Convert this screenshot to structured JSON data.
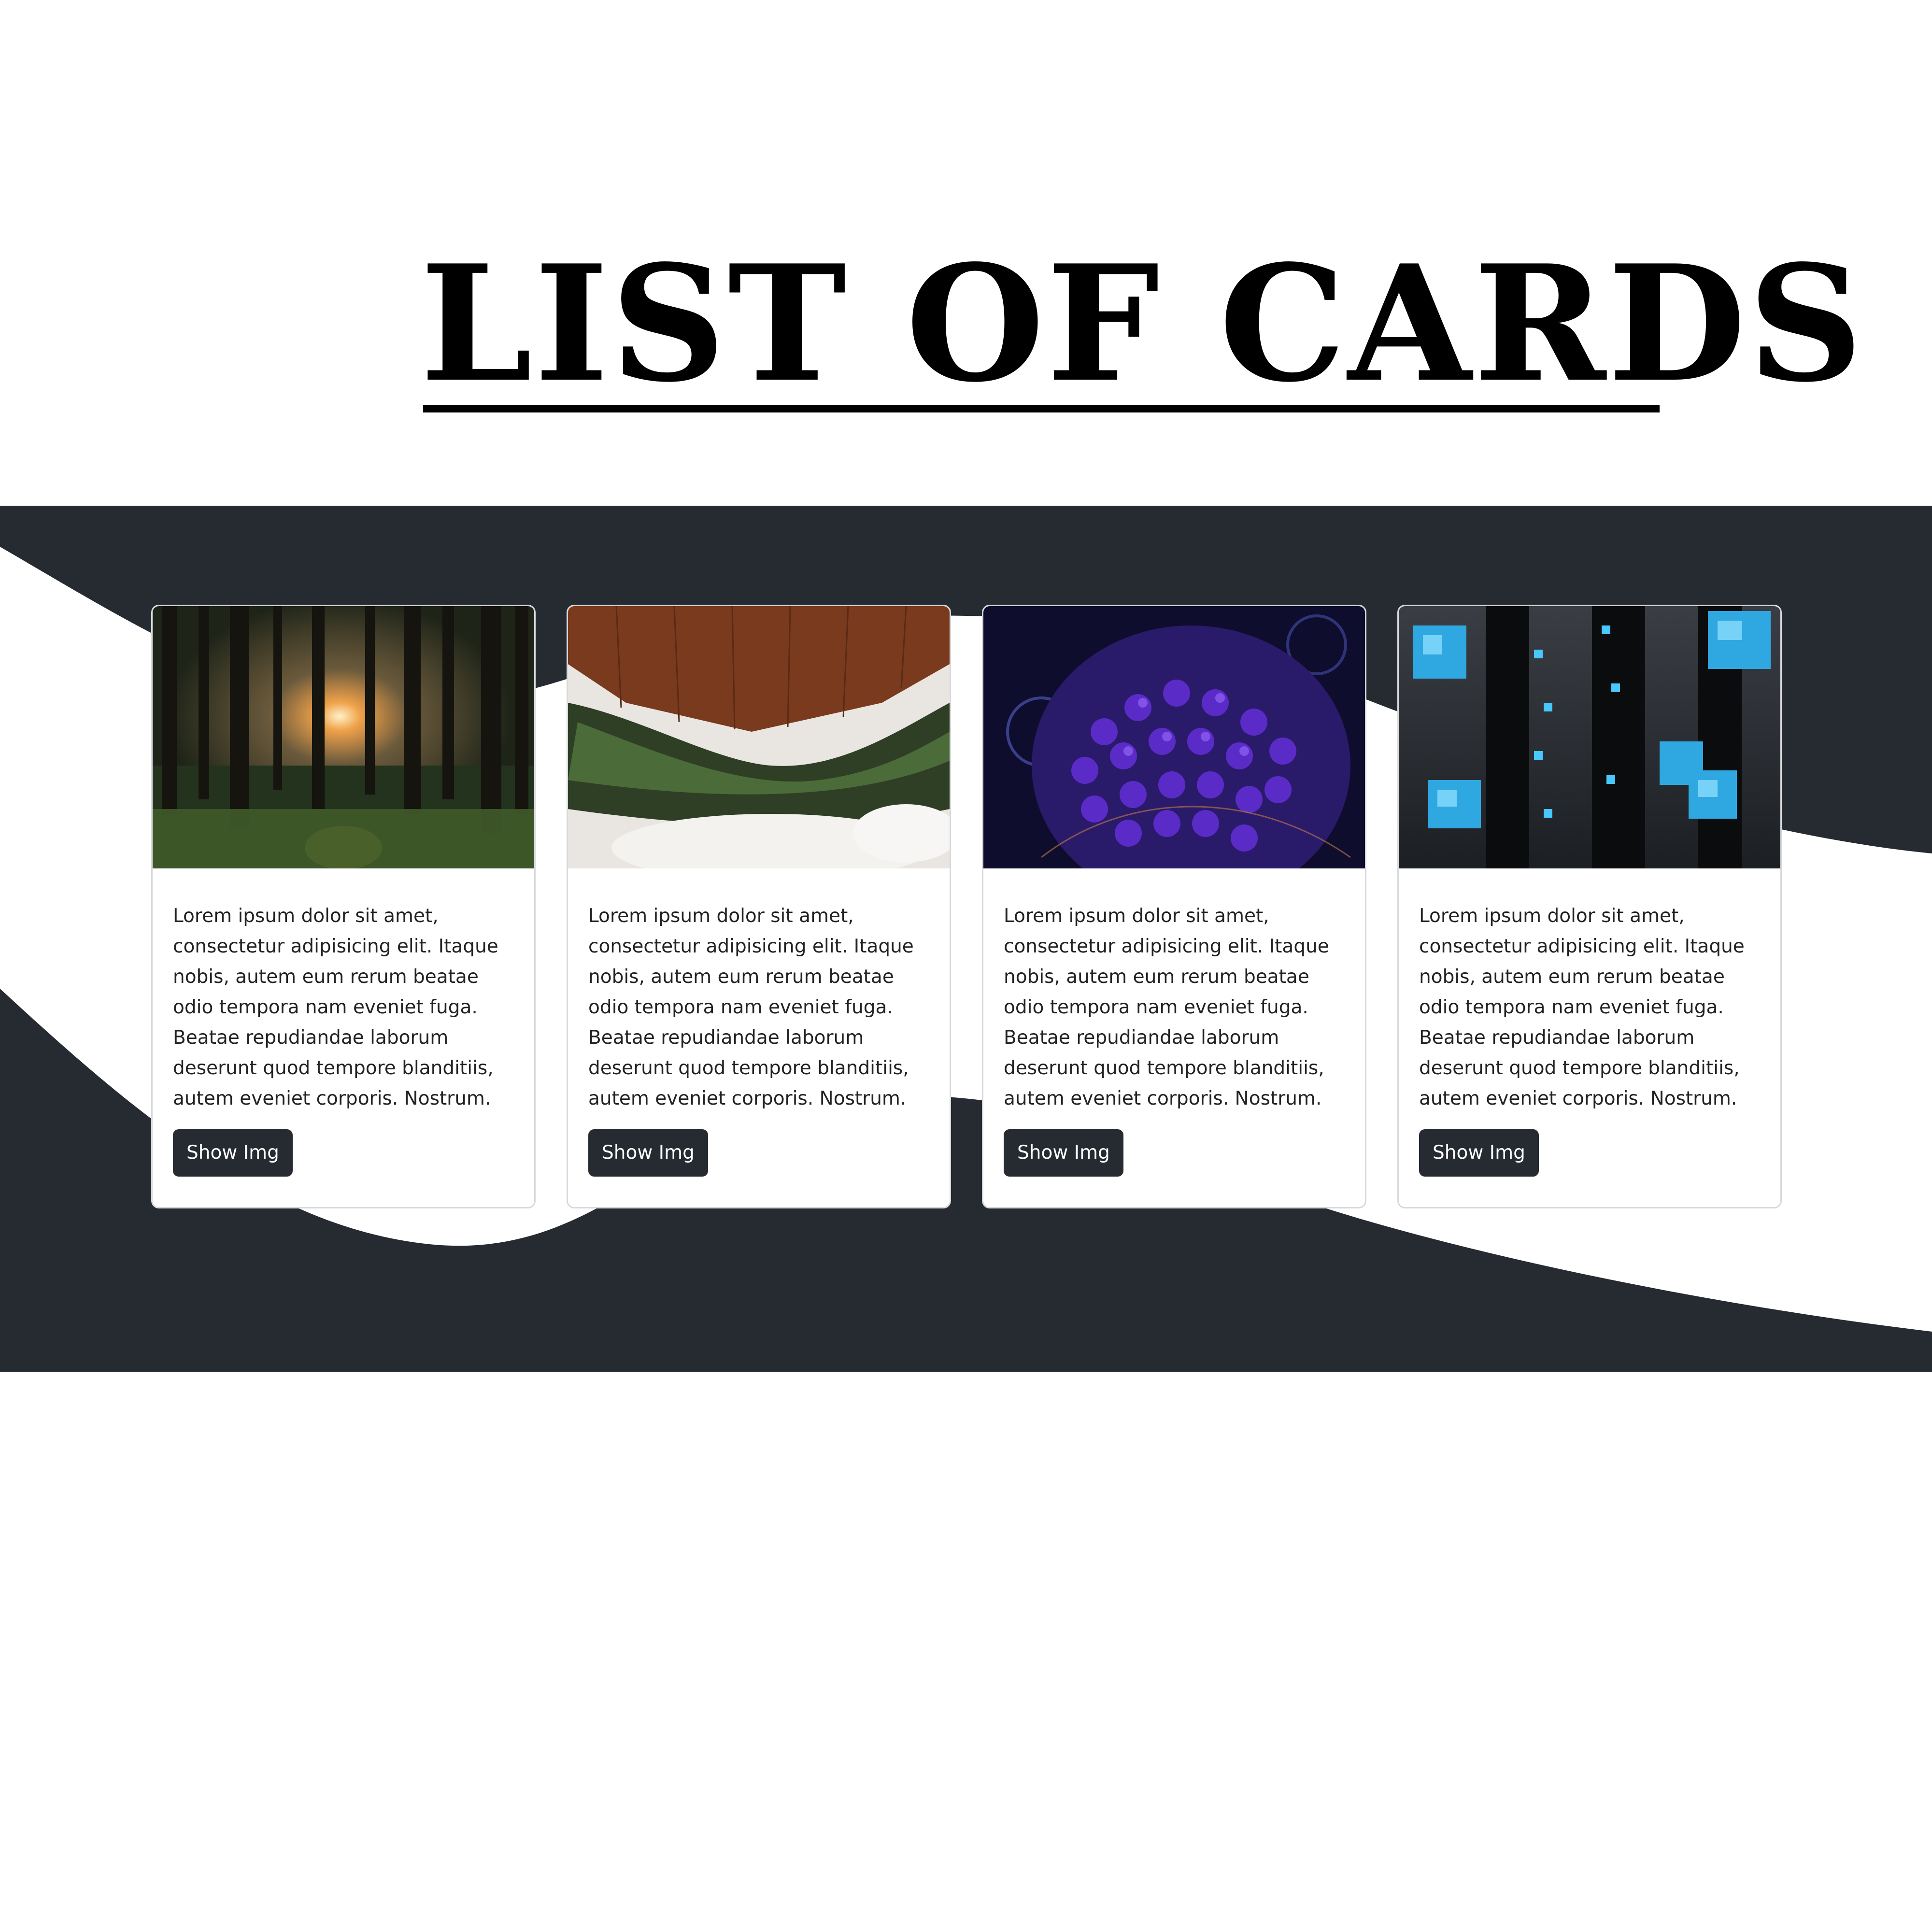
{
  "page": {
    "title": "LIST OF CARDS"
  },
  "colors": {
    "band_dark": "#262b32",
    "wave_light": "#ffffff",
    "button_bg": "#262b32",
    "button_text": "#ffffff",
    "card_border": "#d7d9dc"
  },
  "cards": [
    {
      "image": "forest-sunrise-image",
      "text": "Lorem ipsum dolor sit amet, consectetur adipisicing elit. Itaque nobis, autem eum rerum beatae odio tempora nam eveniet fuga. Beatae repudiandae laborum deserunt quod tempore blanditiis, autem eveniet corporis. Nostrum.",
      "button_label": "Show Img"
    },
    {
      "image": "pine-branches-snow-image",
      "text": "Lorem ipsum dolor sit amet, consectetur adipisicing elit. Itaque nobis, autem eum rerum beatae odio tempora nam eveniet fuga. Beatae repudiandae laborum deserunt quod tempore blanditiis, autem eveniet corporis. Nostrum.",
      "button_label": "Show Img"
    },
    {
      "image": "purple-geodesic-sphere-image",
      "text": "Lorem ipsum dolor sit amet, consectetur adipisicing elit. Itaque nobis, autem eum rerum beatae odio tempora nam eveniet fuga. Beatae repudiandae laborum deserunt quod tempore blanditiis, autem eveniet corporis. Nostrum.",
      "button_label": "Show Img"
    },
    {
      "image": "blue-cubes-image",
      "text": "Lorem ipsum dolor sit amet, consectetur adipisicing elit. Itaque nobis, autem eum rerum beatae odio tempora nam eveniet fuga. Beatae repudiandae laborum deserunt quod tempore blanditiis, autem eveniet corporis. Nostrum.",
      "button_label": "Show Img"
    }
  ]
}
